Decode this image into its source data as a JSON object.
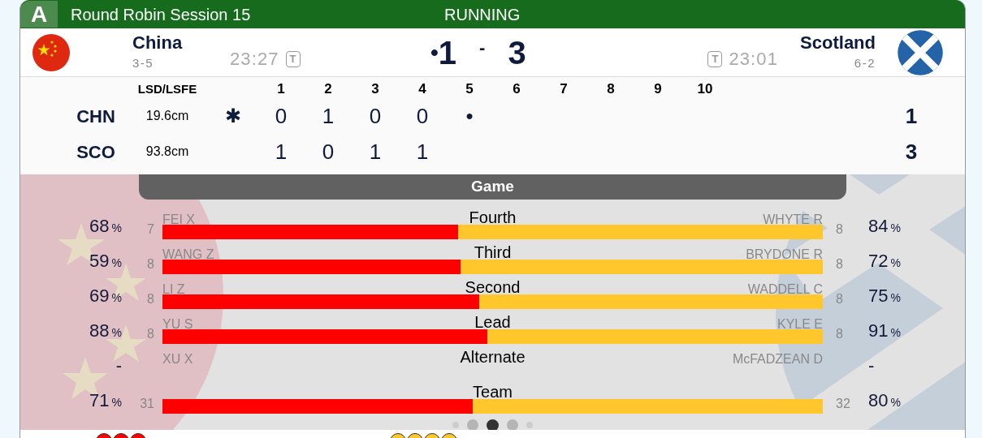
{
  "header": {
    "sheet": "A",
    "title": "Round Robin Session 15",
    "status": "RUNNING"
  },
  "teams": [
    {
      "name": "China",
      "record": "3-5",
      "time": "23:27",
      "timeout_icon": "T",
      "score": "1",
      "hammer_dot": "•",
      "kind": "china"
    },
    {
      "name": "Scotland",
      "record": "6-2",
      "time": "23:01",
      "timeout_icon": "T",
      "score": "3",
      "kind": "scotland"
    }
  ],
  "score_separator": "-",
  "linescore": {
    "lsd_heading": "LSD/LSFE",
    "end_headings": [
      "1",
      "2",
      "3",
      "4",
      "5",
      "6",
      "7",
      "8",
      "9",
      "10"
    ],
    "rows": [
      {
        "abbr": "CHN",
        "lsd": "19.6cm",
        "hammer": "✱",
        "ends": [
          "0",
          "1",
          "0",
          "0",
          "•"
        ],
        "total": "1"
      },
      {
        "abbr": "SCO",
        "lsd": "93.8cm",
        "ends": [
          "1",
          "0",
          "1",
          "1"
        ],
        "total": "3"
      }
    ]
  },
  "game_tab": "Game",
  "players": [
    {
      "position": "Fourth",
      "left": {
        "name": "FEI X",
        "shots": "7",
        "pct": "68",
        "unit": "%"
      },
      "right": {
        "name": "WHYTE R",
        "shots": "8",
        "pct": "84",
        "unit": "%"
      },
      "level": 0.448
    },
    {
      "position": "Third",
      "left": {
        "name": "WANG Z",
        "shots": "8",
        "pct": "59",
        "unit": "%"
      },
      "right": {
        "name": "BRYDONE R",
        "shots": "8",
        "pct": "72",
        "unit": "%"
      },
      "level": 0.451
    },
    {
      "position": "Second",
      "left": {
        "name": "LI Z",
        "shots": "8",
        "pct": "69",
        "unit": "%"
      },
      "right": {
        "name": "WADDELL C",
        "shots": "8",
        "pct": "75",
        "unit": "%"
      },
      "level": 0.48
    },
    {
      "position": "Lead",
      "left": {
        "name": "YU S",
        "shots": "8",
        "pct": "88",
        "unit": "%"
      },
      "right": {
        "name": "KYLE E",
        "shots": "8",
        "pct": "91",
        "unit": "%"
      },
      "level": 0.492
    },
    {
      "position": "Alternate",
      "left": {
        "name": "XU X",
        "pct": "-"
      },
      "right": {
        "name": "McFADZEAN D",
        "pct": "-"
      }
    },
    {
      "position": "Team",
      "left": {
        "shots": "31",
        "pct": "71",
        "unit": "%"
      },
      "right": {
        "shots": "32",
        "pct": "80",
        "unit": "%"
      },
      "level": 0.47
    }
  ],
  "pager": [
    {
      "selected": false
    },
    {
      "selected": false
    },
    {
      "selected": true
    },
    {
      "selected": false
    },
    {
      "selected": false
    }
  ],
  "stones": [
    {
      "color": "#ff0000"
    },
    {
      "color": "#ff0000"
    },
    {
      "color": "#ff0000"
    },
    {
      "color": "#ffc72c"
    },
    {
      "color": "#ffc72c"
    },
    {
      "color": "#ffc72c"
    },
    {
      "color": "#ffc72c"
    }
  ]
}
